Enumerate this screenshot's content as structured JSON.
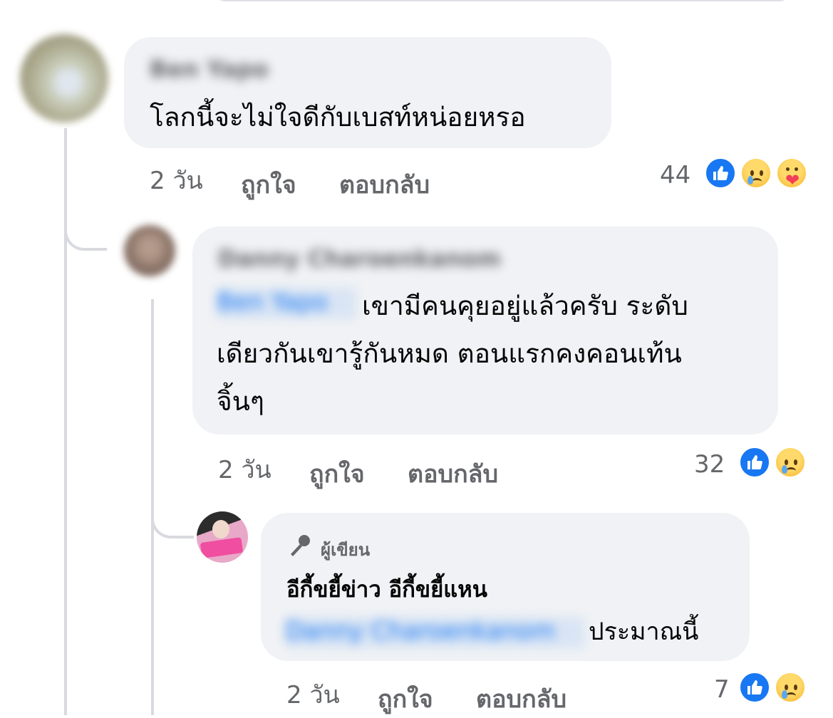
{
  "comments": [
    {
      "author": "Ben Yapo",
      "text": "โลกนี้จะไม่ใจดีกับเบสท์หน่อยหรอ",
      "time": "2 วัน",
      "like_label": "ถูกใจ",
      "reply_label": "ตอบกลับ",
      "reaction_count": "44",
      "reactions": [
        "like-icon",
        "sad-icon",
        "care-icon"
      ]
    },
    {
      "author": "Danny Charoenkanom",
      "mention": "Ben Yapo",
      "text_lines": [
        "เขามีคนคุยอยู่แล้วครับ ระดับ",
        "เดียวกันเขารู้กันหมด ตอนแรกคงคอนเท้น",
        "จิ้นๆ"
      ],
      "time": "2 วัน",
      "like_label": "ถูกใจ",
      "reply_label": "ตอบกลับ",
      "reaction_count": "32",
      "reactions": [
        "like-icon",
        "sad-icon"
      ]
    },
    {
      "badge": "ผู้เขียน",
      "line1": "อีกี้ขยี้ข่าว อีกี้ขยี้แหน",
      "mention": "Danny Charoenkanom",
      "line2": "ประมาณนี้",
      "time": "2 วัน",
      "like_label": "ถูกใจ",
      "reply_label": "ตอบกลับ",
      "reaction_count": "7",
      "reactions": [
        "like-icon",
        "sad-icon"
      ]
    }
  ],
  "colors": {
    "bubble": "#f0f2f5",
    "meta_text": "#65676b",
    "like_blue": "#1877f2",
    "thread_line": "#d8dadf"
  }
}
